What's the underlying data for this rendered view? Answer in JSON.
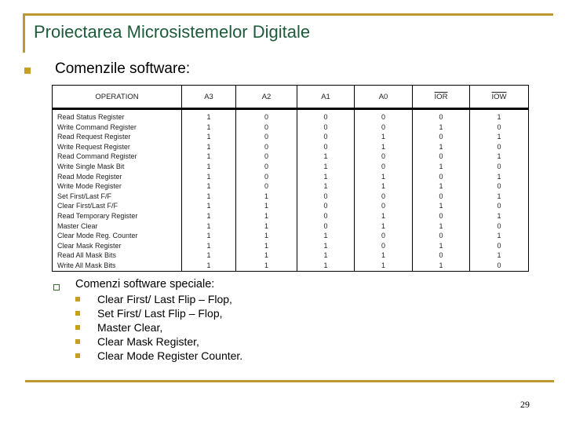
{
  "slide": {
    "title": "Proiectarea Microsistemelor Digitale",
    "main_bullet": "Comenzile software:",
    "page_number": "29",
    "accent_color": "#b89a2e",
    "title_color": "#1e5b3a"
  },
  "table": {
    "headers": [
      "OPERATION",
      "A3",
      "A2",
      "A1",
      "A0",
      "IOR",
      "IOW"
    ],
    "overlined_headers": [
      "IOR",
      "IOW"
    ],
    "rows": [
      [
        "Read Status Register",
        "1",
        "0",
        "0",
        "0",
        "0",
        "1"
      ],
      [
        "Write Command Register",
        "1",
        "0",
        "0",
        "0",
        "1",
        "0"
      ],
      [
        "Read Request Register",
        "1",
        "0",
        "0",
        "1",
        "0",
        "1"
      ],
      [
        "Write Request Register",
        "1",
        "0",
        "0",
        "1",
        "1",
        "0"
      ],
      [
        "Read Command Register",
        "1",
        "0",
        "1",
        "0",
        "0",
        "1"
      ],
      [
        "Write Single Mask Bit",
        "1",
        "0",
        "1",
        "0",
        "1",
        "0"
      ],
      [
        "Read Mode Register",
        "1",
        "0",
        "1",
        "1",
        "0",
        "1"
      ],
      [
        "Write Mode Register",
        "1",
        "0",
        "1",
        "1",
        "1",
        "0"
      ],
      [
        "Set First/Last F/F",
        "1",
        "1",
        "0",
        "0",
        "0",
        "1"
      ],
      [
        "Clear First/Last F/F",
        "1",
        "1",
        "0",
        "0",
        "1",
        "0"
      ],
      [
        "Read Temporary Register",
        "1",
        "1",
        "0",
        "1",
        "0",
        "1"
      ],
      [
        "Master Clear",
        "1",
        "1",
        "0",
        "1",
        "1",
        "0"
      ],
      [
        "Clear Mode Reg. Counter",
        "1",
        "1",
        "1",
        "0",
        "0",
        "1"
      ],
      [
        "Clear Mask Register",
        "1",
        "1",
        "1",
        "0",
        "1",
        "0"
      ],
      [
        "Read All Mask Bits",
        "1",
        "1",
        "1",
        "1",
        "0",
        "1"
      ],
      [
        "Write All Mask Bits",
        "1",
        "1",
        "1",
        "1",
        "1",
        "0"
      ]
    ]
  },
  "special": {
    "heading": "Comenzi software speciale:",
    "items": [
      "Clear First/ Last Flip – Flop,",
      "Set First/ Last Flip – Flop,",
      "Master Clear,",
      "Clear Mask Register,",
      "Clear Mode Register Counter."
    ]
  }
}
